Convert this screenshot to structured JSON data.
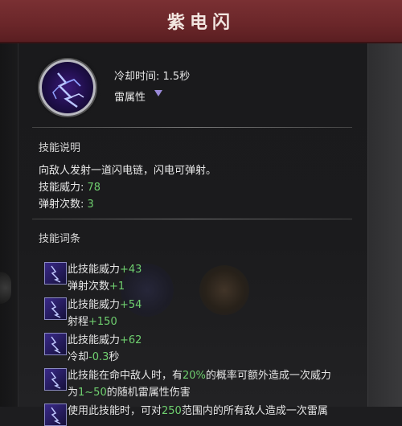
{
  "header": {
    "title": "紫电闪"
  },
  "skill": {
    "icon": "lightning-icon",
    "cooldown_label": "冷却时间:",
    "cooldown_value": "1.5秒",
    "element": "雷属性"
  },
  "description": {
    "title": "技能说明",
    "text": "向敌人发射一道闪电链，闪电可弹射。",
    "power_label": "技能威力:",
    "power_value": "78",
    "bounce_label": "弹射次数:",
    "bounce_value": "3"
  },
  "entries": {
    "title": "技能词条",
    "items": [
      {
        "l1a": "此技能威力",
        "l1b": "+43",
        "l2a": "弹射次数",
        "l2b": "+1"
      },
      {
        "l1a": "此技能威力",
        "l1b": "+54",
        "l2a": "射程",
        "l2b": "+150"
      },
      {
        "l1a": "此技能威力",
        "l1b": "+62",
        "l2a": "冷却",
        "l2b": "-0.3",
        "l2c": "秒"
      },
      {
        "l1a": "此技能在命中敌人时，有",
        "l1b": "20%",
        "l1c": "的概率可额外造成一次威力",
        "l2a": "为",
        "l2b": "1~50",
        "l2c": "的随机雷属性伤害"
      },
      {
        "l1a": "使用此技能时，可对",
        "l1b": "250",
        "l1c": "范围内的所有敌人造成一次雷属"
      }
    ]
  },
  "colors": {
    "header": "#6a2629",
    "value_green": "#6fd06f",
    "text": "#e6e6e6"
  }
}
